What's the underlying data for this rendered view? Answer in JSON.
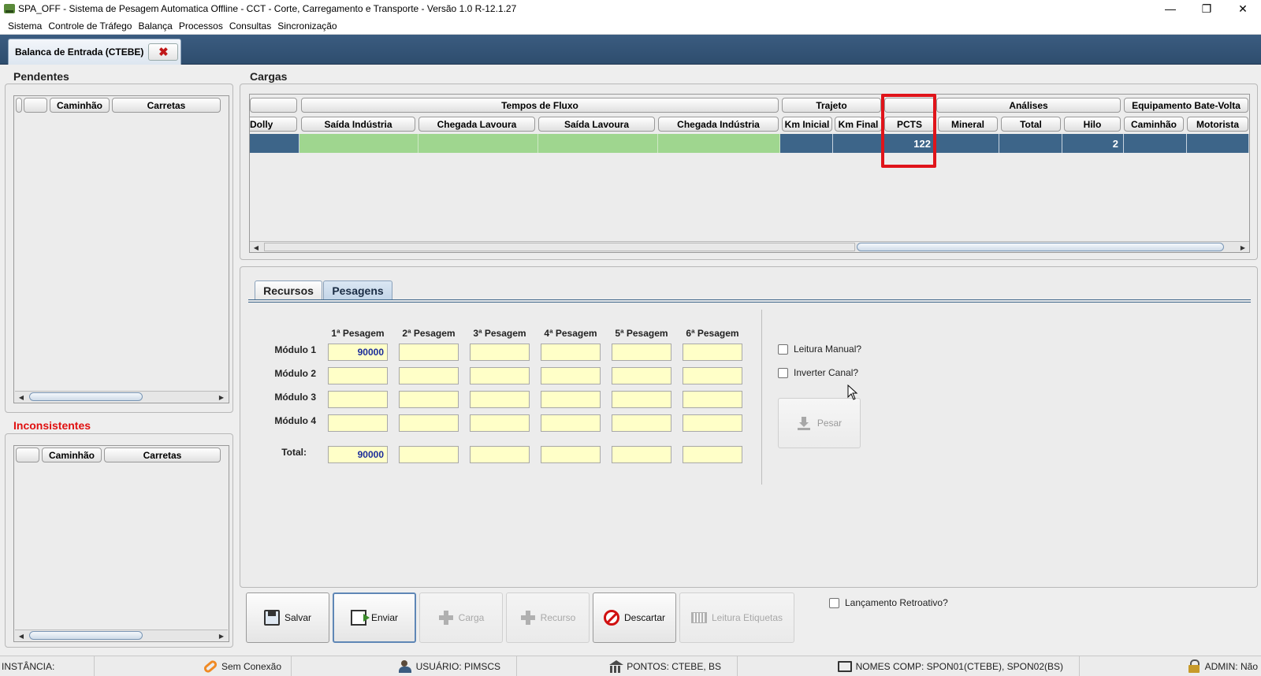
{
  "window": {
    "title": "SPA_OFF - Sistema de Pesagem Automatica Offline - CCT - Corte, Carregamento e Transporte - Versão 1.0 R-12.1.27",
    "minimize": "—",
    "maximize": "❐",
    "close": "✕"
  },
  "menu": [
    "Sistema",
    "Controle de Tráfego",
    "Balança",
    "Processos",
    "Consultas",
    "Sincronização"
  ],
  "doc_tab": {
    "label": "Balanca de Entrada (CTEBE)",
    "close": "✖"
  },
  "pendentes": {
    "title": "Pendentes",
    "columns": [
      "",
      "Caminhão",
      "Carretas"
    ]
  },
  "inconsistentes": {
    "title": "Inconsistentes",
    "columns": [
      "",
      "Caminhão",
      "Carretas"
    ]
  },
  "cargas": {
    "title": "Cargas",
    "group_headers": [
      "",
      "Tempos de Fluxo",
      "Trajeto",
      "",
      "Análises",
      "Equipamento Bate-Volta"
    ],
    "columns": [
      "Dolly",
      "Saída Indústria",
      "Chegada Lavoura",
      "Saída Lavoura",
      "Chegada Indústria",
      "Km Inicial",
      "Km Final",
      "PCTS",
      "Mineral",
      "Total",
      "Hilo",
      "Caminhão",
      "Motorista"
    ],
    "row": [
      "",
      "",
      "",
      "",
      "",
      "",
      "",
      "122",
      "",
      "",
      "2",
      "",
      ""
    ],
    "highlight_column": "PCTS"
  },
  "tabs": {
    "recursos": "Recursos",
    "pesagens": "Pesagens",
    "active": "Pesagens"
  },
  "pesagens": {
    "columns": [
      "1ª Pesagem",
      "2ª Pesagem",
      "3ª Pesagem",
      "4ª Pesagem",
      "5ª Pesagem",
      "6ª Pesagem"
    ],
    "rows": [
      {
        "label": "Módulo 1",
        "values": [
          "90000",
          "",
          "",
          "",
          "",
          ""
        ]
      },
      {
        "label": "Módulo 2",
        "values": [
          "",
          "",
          "",
          "",
          "",
          ""
        ]
      },
      {
        "label": "Módulo 3",
        "values": [
          "",
          "",
          "",
          "",
          "",
          ""
        ]
      },
      {
        "label": "Módulo 4",
        "values": [
          "",
          "",
          "",
          "",
          "",
          ""
        ]
      }
    ],
    "total": {
      "label": "Total:",
      "values": [
        "90000",
        "",
        "",
        "",
        "",
        ""
      ]
    },
    "leitura_manual": "Leitura Manual?",
    "inverter_canal": "Inverter Canal?",
    "pesar": "Pesar"
  },
  "actions": {
    "salvar": "Salvar",
    "enviar": "Enviar",
    "carga": "Carga",
    "recurso": "Recurso",
    "descartar": "Descartar",
    "leitura_etiquetas": "Leitura Etiquetas",
    "lancamento_retroativo": "Lançamento Retroativo?"
  },
  "status": {
    "instancia": "INSTÂNCIA:",
    "conexao": "Sem Conexão",
    "usuario": "USUÁRIO: PIMSCS",
    "pontos": "PONTOS: CTEBE, BS",
    "nomes_comp": "NOMES COMP: SPON01(CTEBE), SPON02(BS)",
    "admin": "ADMIN: Não"
  },
  "colors": {
    "row_blue": "#3d6589",
    "row_green": "#9fd68f",
    "input_yellow": "#ffffc8",
    "highlight_red": "#e0141a",
    "label_red": "#e01010"
  }
}
